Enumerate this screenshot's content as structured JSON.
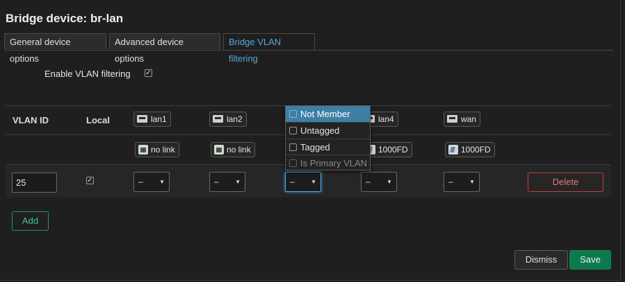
{
  "dialog": {
    "title": "Bridge device: br-lan"
  },
  "tabs": [
    {
      "label": "General device options",
      "active": false
    },
    {
      "label": "Advanced device options",
      "active": false
    },
    {
      "label": "Bridge VLAN filtering",
      "active": true
    }
  ],
  "vlan_filtering": {
    "label": "Enable VLAN filtering",
    "checked": true
  },
  "table": {
    "headers": {
      "vlan_id": "VLAN ID",
      "local": "Local"
    },
    "ports": [
      {
        "name": "lan1",
        "status": "no link"
      },
      {
        "name": "lan2",
        "status": "no link"
      },
      {
        "name": "lan3",
        "status": ""
      },
      {
        "name": "lan4",
        "status": "1000FD"
      },
      {
        "name": "wan",
        "status": "1000FD"
      }
    ],
    "row": {
      "vlan_id": "25",
      "local": true,
      "port_values": [
        "–",
        "–",
        "–",
        "–",
        "–"
      ],
      "delete_label": "Delete"
    }
  },
  "dropdown": {
    "options": [
      {
        "label": "Not Member",
        "checked": true,
        "highlighted": true
      },
      {
        "label": "Untagged",
        "checked": false
      },
      {
        "label": "Tagged",
        "checked": false
      },
      {
        "label": "Is Primary VLAN",
        "checked": false,
        "disabled": true
      }
    ]
  },
  "buttons": {
    "add": "Add",
    "dismiss": "Dismiss",
    "save": "Save"
  },
  "colors": {
    "accent": "#5aa7d8",
    "danger": "#c5413f",
    "positive": "#0d7a4d"
  }
}
